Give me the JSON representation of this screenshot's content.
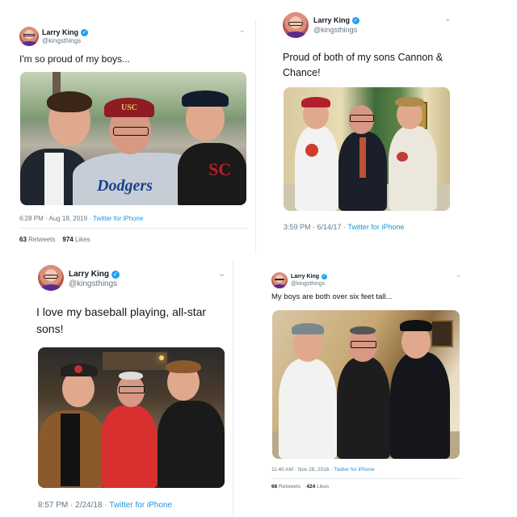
{
  "tweets": [
    {
      "name": "Larry King",
      "handle": "@kingsthings",
      "text": "I'm so proud of my boys...",
      "time": "6:28 PM · Aug 18, 2019",
      "source": "Twitter for iPhone",
      "retweets": "63",
      "retweets_label": "Retweets",
      "likes": "974",
      "likes_label": "Likes",
      "photo_caps": [
        "USC",
        "Dodgers",
        "SC"
      ]
    },
    {
      "name": "Larry King",
      "handle": "@kingsthings",
      "text": "Proud of both of my sons Cannon & Chance!",
      "time": "3:59 PM · 6/14/17",
      "source": "Twitter for iPhone"
    },
    {
      "name": "Larry King",
      "handle": "@kingsthings",
      "text": "I love my baseball playing, all-star sons!",
      "time": "8:57 PM · 2/24/18",
      "source": "Twitter for iPhone"
    },
    {
      "name": "Larry King",
      "handle": "@kingsthings",
      "text": "My boys are both over six feet tall...",
      "time": "11:40 AM · Nov 28, 2016",
      "source": "Twitter for iPhone",
      "retweets": "66",
      "retweets_label": "Retweets",
      "likes": "424",
      "likes_label": "Likes"
    }
  ],
  "icons": {
    "verified": "verified-badge-icon",
    "chevron": "chevron-down-icon",
    "accent": "#1da1f2",
    "link": "#1b95e0"
  }
}
